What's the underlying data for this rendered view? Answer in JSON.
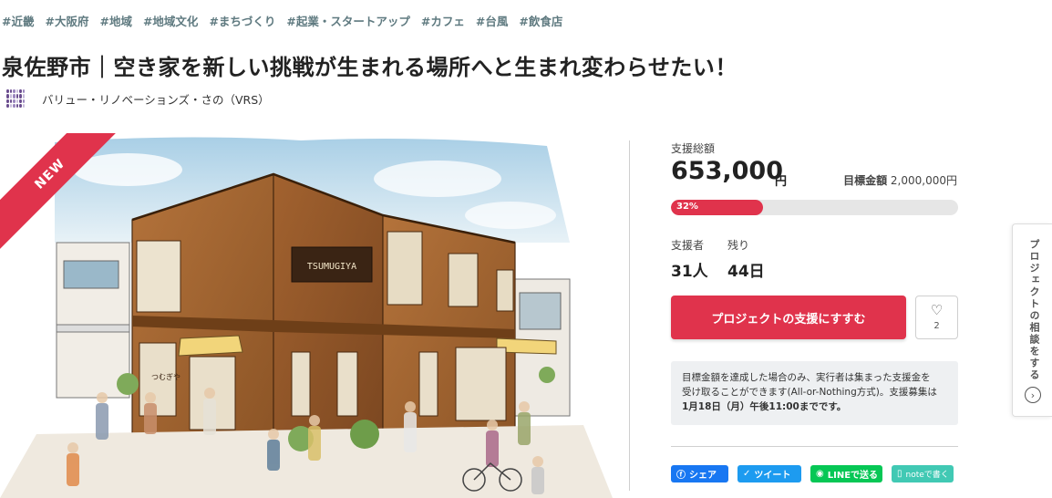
{
  "tags": [
    "#近畿",
    "#大阪府",
    "#地域",
    "#地域文化",
    "#まちづくり",
    "#起業・スタートアップ",
    "#カフェ",
    "#台風",
    "#飲食店"
  ],
  "project_title": "泉佐野市｜空き家を新しい挑戦が生まれる場所へと生まれ変わらせたい！",
  "owner": {
    "name": "バリュー・リノベーションズ・さの（VRS）",
    "logo_icon": "owner-logo-icon"
  },
  "hero": {
    "badge": "NEW",
    "sign_text": "TSUMUGIYA",
    "small_sign": "つむぎや"
  },
  "funding": {
    "total_label": "支援総額",
    "total_amount": "653,000",
    "currency_unit": "円",
    "goal_label": "目標金額",
    "goal_amount": "2,000,000円",
    "progress_percent": 32,
    "progress_text": "32%",
    "supporters_label": "支援者",
    "supporters_value": "31人",
    "remaining_label": "残り",
    "remaining_value": "44日"
  },
  "actions": {
    "support_button": "プロジェクトの支援にすすむ",
    "like_icon": "heart-icon",
    "like_count": "2"
  },
  "notice": {
    "line1": "目標金額を達成した場合のみ、実行者は集まった支援金を",
    "line2": "受け取ることができます(All-or-Nothing方式)。支援募集は",
    "line3": "1月18日（月）午後11:00までです。"
  },
  "share": {
    "facebook": "シェア",
    "twitter": "ツイート",
    "line": "LINEで送る",
    "note": "noteで書く"
  },
  "side_tab": {
    "label": "プロジェクトの相談をする",
    "arrow_icon": "chevron-right-icon"
  },
  "colors": {
    "accent": "#e0334c",
    "tag": "#5f7a80",
    "facebook": "#1877f2",
    "twitter": "#1d9bf0",
    "line": "#06c755",
    "note": "#41c9b4"
  }
}
